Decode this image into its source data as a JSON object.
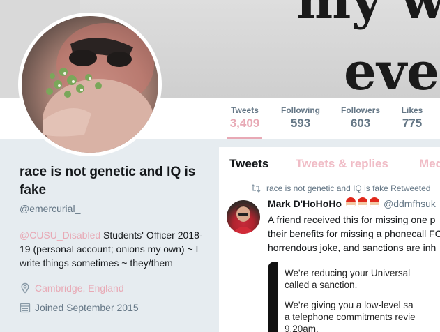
{
  "banner": {
    "text_top": "my whe",
    "text_bottom": "everyt"
  },
  "stats": [
    {
      "label": "Tweets",
      "value": "3,409"
    },
    {
      "label": "Following",
      "value": "593"
    },
    {
      "label": "Followers",
      "value": "603"
    },
    {
      "label": "Likes",
      "value": "775"
    }
  ],
  "profile": {
    "name": "race is not genetic and IQ is fake",
    "handle": "@emercurial_",
    "bio_mention": "@CUSU_Disabled",
    "bio_text": " Students' Officer 2018-19 (personal account; onions my own) ~ I write things sometimes ~ they/them",
    "location": "Cambridge, England",
    "joined": "Joined September 2015"
  },
  "timeline": {
    "tabs": [
      "Tweets",
      "Tweets & replies",
      "Media"
    ],
    "retweet_line": "race is not genetic and IQ is fake Retweeted",
    "tweet": {
      "author_name": "Mark D'HoHoHo",
      "author_handle": "@ddmfhsuk",
      "text_lines": [
        "A friend received this for missing one p",
        "their benefits for missing a phonecall FC",
        "horrendous joke, and sanctions are inh"
      ],
      "embed_lines_1": [
        "We're reducing your Universal",
        "called a sanction."
      ],
      "embed_lines_2": [
        "We're giving you a low-level sa",
        "a telephone commitments revie",
        "9.20am."
      ]
    }
  },
  "colors": {
    "accent": "#e8a9b5",
    "muted": "#657786",
    "background": "#e6ecf0"
  }
}
